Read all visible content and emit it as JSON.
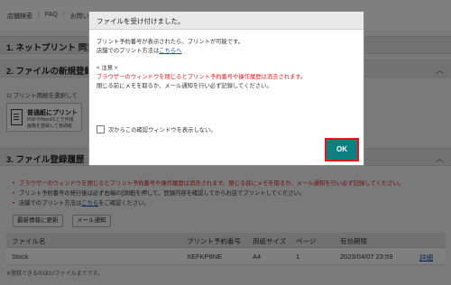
{
  "topnav": {
    "links": [
      "店舗検索",
      "FAQ",
      "お問い"
    ]
  },
  "sections": {
    "s1": "1. ネットプリント 同意",
    "s2": "2. ファイルの新規登録",
    "s3": "3. ファイル登録履歴（"
  },
  "upload": {
    "instruction": "1) プリント用紙を選択して",
    "card_title": "普通紙にプリント",
    "card_line1": "PDFやWordなどで作成",
    "card_line2": "画像を登録して普通紙"
  },
  "notes": {
    "n1": "ブラウザーのウィンドウを閉じるとプリント予約番号や操作履歴は消去されます。閉じる前にメモを取るか、メール通知を行い必ず記録してください。",
    "n2": "プリント予約番号の発行後は必ず右端の[詳細]を押して、登録内容を確認してからお店でプリントしてください。",
    "n3_prefix": "店舗でのプリント方法は",
    "n3_link": "こちら",
    "n3_suffix": "をご確認ください。"
  },
  "buttons": {
    "refresh": "最新情報に更新",
    "mail": "メール通知"
  },
  "table": {
    "headers": [
      "ファイル名",
      "プリント予約番号",
      "用紙サイズ",
      "ページ",
      "有効期限"
    ],
    "rows": [
      {
        "name": "Stock",
        "number": "XEFKP8NE",
        "size": "A4",
        "pages": "1",
        "expiry": "2023/04/07 23:59",
        "detail": "詳細"
      }
    ],
    "footnote": "※登録できるのは10ファイルまでです。"
  },
  "dialog": {
    "title": "ファイルを受け付けました。",
    "line1": "プリント予約番号が表示されたら、プリントが可能です。",
    "line2_prefix": "店舗でのプリント方法は",
    "line2_link": "こちらへ",
    "caution_head": "< 注意 >",
    "caution_red": "ブラウザーのウィンドウを閉じるとプリント予約番号や操作履歴は消去されます。",
    "caution_rest": "閉じる前にメモを取るか、メール通知を行い必ず記録してください。",
    "checkbox_label": "次からこの確認ウィンドウを表示しない。",
    "ok_label": "OK"
  },
  "colors": {
    "ok_button": "#0e7f80",
    "highlight_outline": "#e0141a",
    "warning_text": "#d22222",
    "link": "#1a4ea8"
  }
}
